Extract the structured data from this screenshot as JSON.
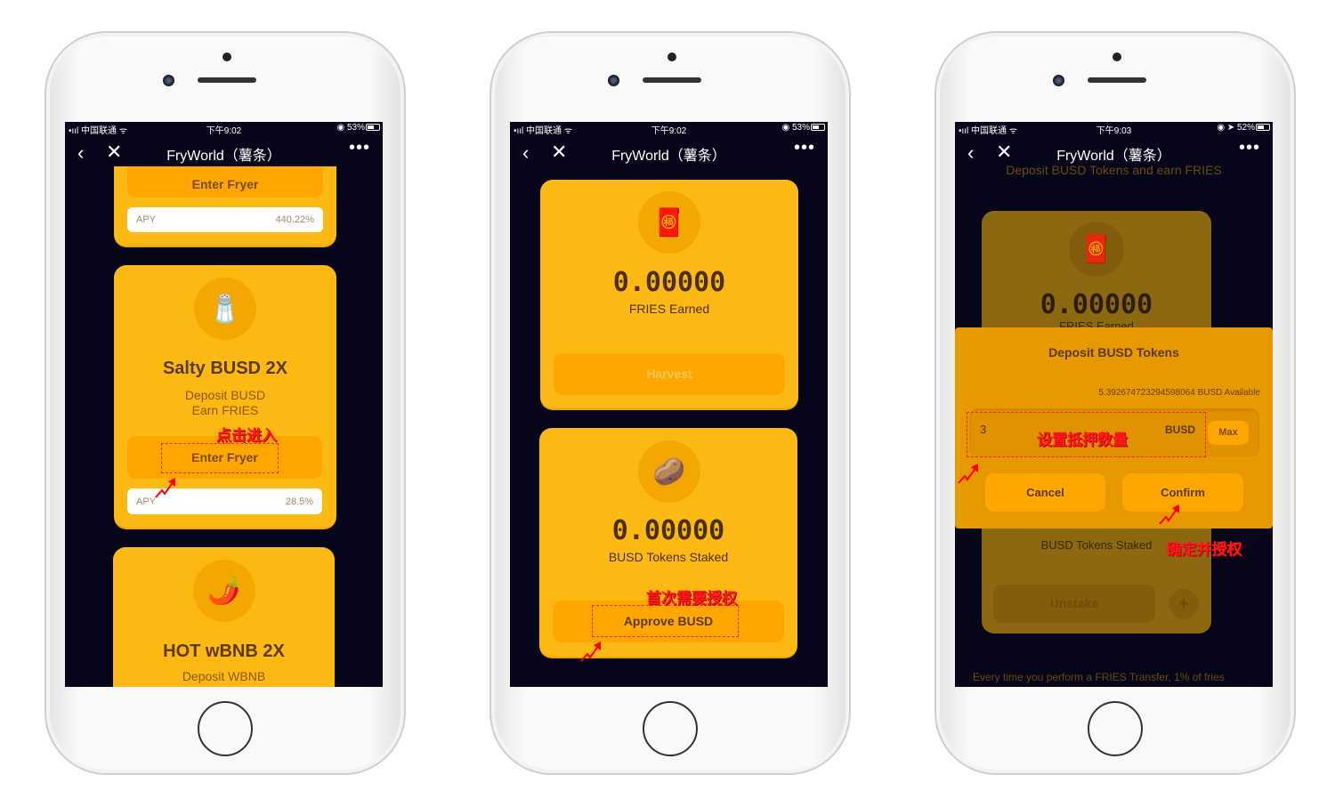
{
  "common": {
    "app_title": "FryWorld（薯条）",
    "back": "‹",
    "close": "✕",
    "more": "•••"
  },
  "phones": [
    {
      "status": {
        "carrier": "•ııl 中国联通 ᯤ",
        "time": "下午9:02",
        "right": "◉ 53%",
        "battery_pct": 53
      },
      "top_card": {
        "enter_label": "Enter Fryer",
        "apy_label": "APY",
        "apy_value": "440.22%"
      },
      "salty": {
        "icon": "salt-shaker-icon",
        "glyph": "🧂",
        "title": "Salty BUSD 2X",
        "line1": "Deposit BUSD",
        "line2": "Earn FRIES",
        "enter_label": "Enter Fryer",
        "apy_label": "APY",
        "apy_value": "28.5%",
        "annotation": "点击进入"
      },
      "hot": {
        "icon": "chili-pepper-icon",
        "glyph": "🌶️",
        "title": "HOT wBNB 2X",
        "line1": "Deposit WBNB"
      }
    },
    {
      "status": {
        "carrier": "•ııl 中国联通 ᯤ",
        "time": "下午9:02",
        "right": "◉ 53%",
        "battery_pct": 53
      },
      "earned": {
        "icon": "red-envelope-icon",
        "glyph": "🧧",
        "value": "0.00000",
        "label": "FRIES Earned",
        "harvest": "Harvest"
      },
      "staked": {
        "icon": "potato-icon",
        "glyph": "🥔",
        "value": "0.00000",
        "label": "BUSD Tokens Staked",
        "approve": "Approve BUSD",
        "annotation": "首次需要授权"
      }
    },
    {
      "status": {
        "carrier": "•ııl 中国联通 ᯤ",
        "time": "下午9:03",
        "right": "◉ ➤ 52%",
        "battery_pct": 52
      },
      "subtitle": "Deposit BUSD Tokens and earn FRIES",
      "card": {
        "glyph": "🧧",
        "value": "0.00000",
        "label": "FRIES Earned",
        "staked_label": "BUSD Tokens Staked",
        "unstake": "Unstake",
        "plus": "+"
      },
      "footer": "Every time you perform a FRIES Transfer, 1% of fries",
      "modal": {
        "title": "Deposit BUSD Tokens",
        "available": "5.392674723294598064 BUSD Available",
        "input_value": "3",
        "unit": "BUSD",
        "max": "Max",
        "cancel": "Cancel",
        "confirm": "Confirm",
        "annotation_input": "设置抵押数量",
        "annotation_confirm": "确定并授权"
      }
    }
  ],
  "colors": {
    "card": "#fdb913",
    "button": "#ffa600",
    "screen_bg": "#07051a",
    "modal": "#e69a00",
    "annotation": "#ff1a1a"
  }
}
